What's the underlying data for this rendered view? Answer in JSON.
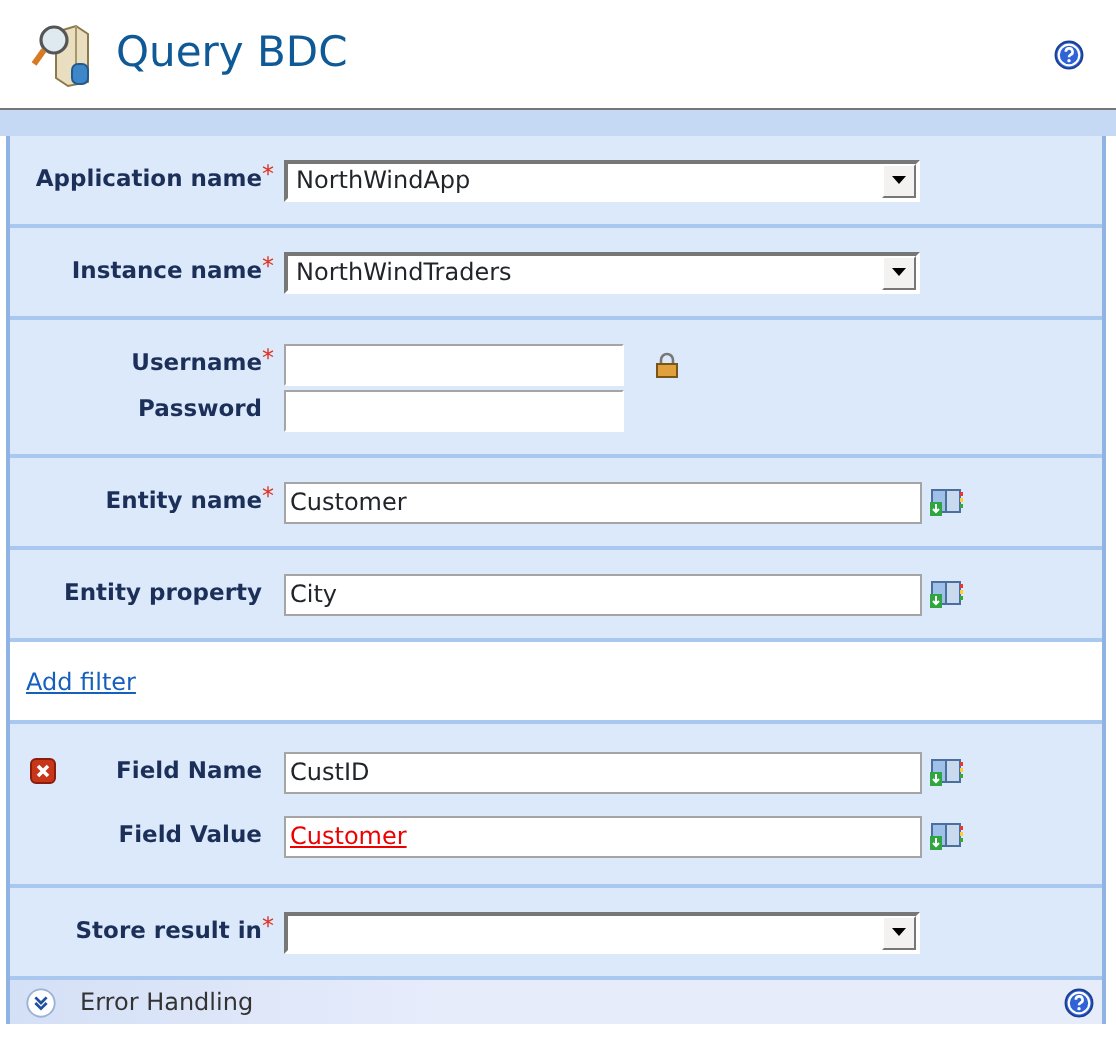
{
  "header": {
    "title": "Query BDC"
  },
  "sections": [
    {
      "kind": "fields",
      "rows": [
        {
          "label": "Application name",
          "required_mark": "*",
          "kind": "select",
          "value": "NorthWindApp"
        }
      ]
    },
    {
      "kind": "fields",
      "rows": [
        {
          "label": "Instance name",
          "required_mark": "*",
          "kind": "select",
          "value": "NorthWindTraders"
        }
      ]
    },
    {
      "kind": "fields",
      "rows": [
        {
          "label": "Username",
          "required_mark": "*",
          "kind": "short",
          "value": "",
          "secure": true
        },
        {
          "label": "Password",
          "kind": "short",
          "value": ""
        }
      ]
    },
    {
      "kind": "fields",
      "rows": [
        {
          "label": "Entity name",
          "required_mark": "*",
          "kind": "text",
          "value": "Customer",
          "lookup": true
        }
      ]
    },
    {
      "kind": "fields",
      "rows": [
        {
          "label": "Entity property",
          "kind": "text",
          "value": "City",
          "lookup": true
        }
      ]
    },
    {
      "kind": "link",
      "text": "Add filter"
    },
    {
      "kind": "fields",
      "removable": true,
      "rows": [
        {
          "label": "Field Name",
          "kind": "text",
          "value": "CustID",
          "lookup": true
        },
        {
          "label": "Field Value",
          "kind": "text",
          "value": "Customer",
          "lookup": true,
          "unresolved": true
        }
      ]
    },
    {
      "kind": "fields",
      "rows": [
        {
          "label": "Store result in",
          "required_mark": "*",
          "kind": "select",
          "value": ""
        }
      ]
    }
  ],
  "collapsible": {
    "title": "Error Handling",
    "expanded": false
  }
}
